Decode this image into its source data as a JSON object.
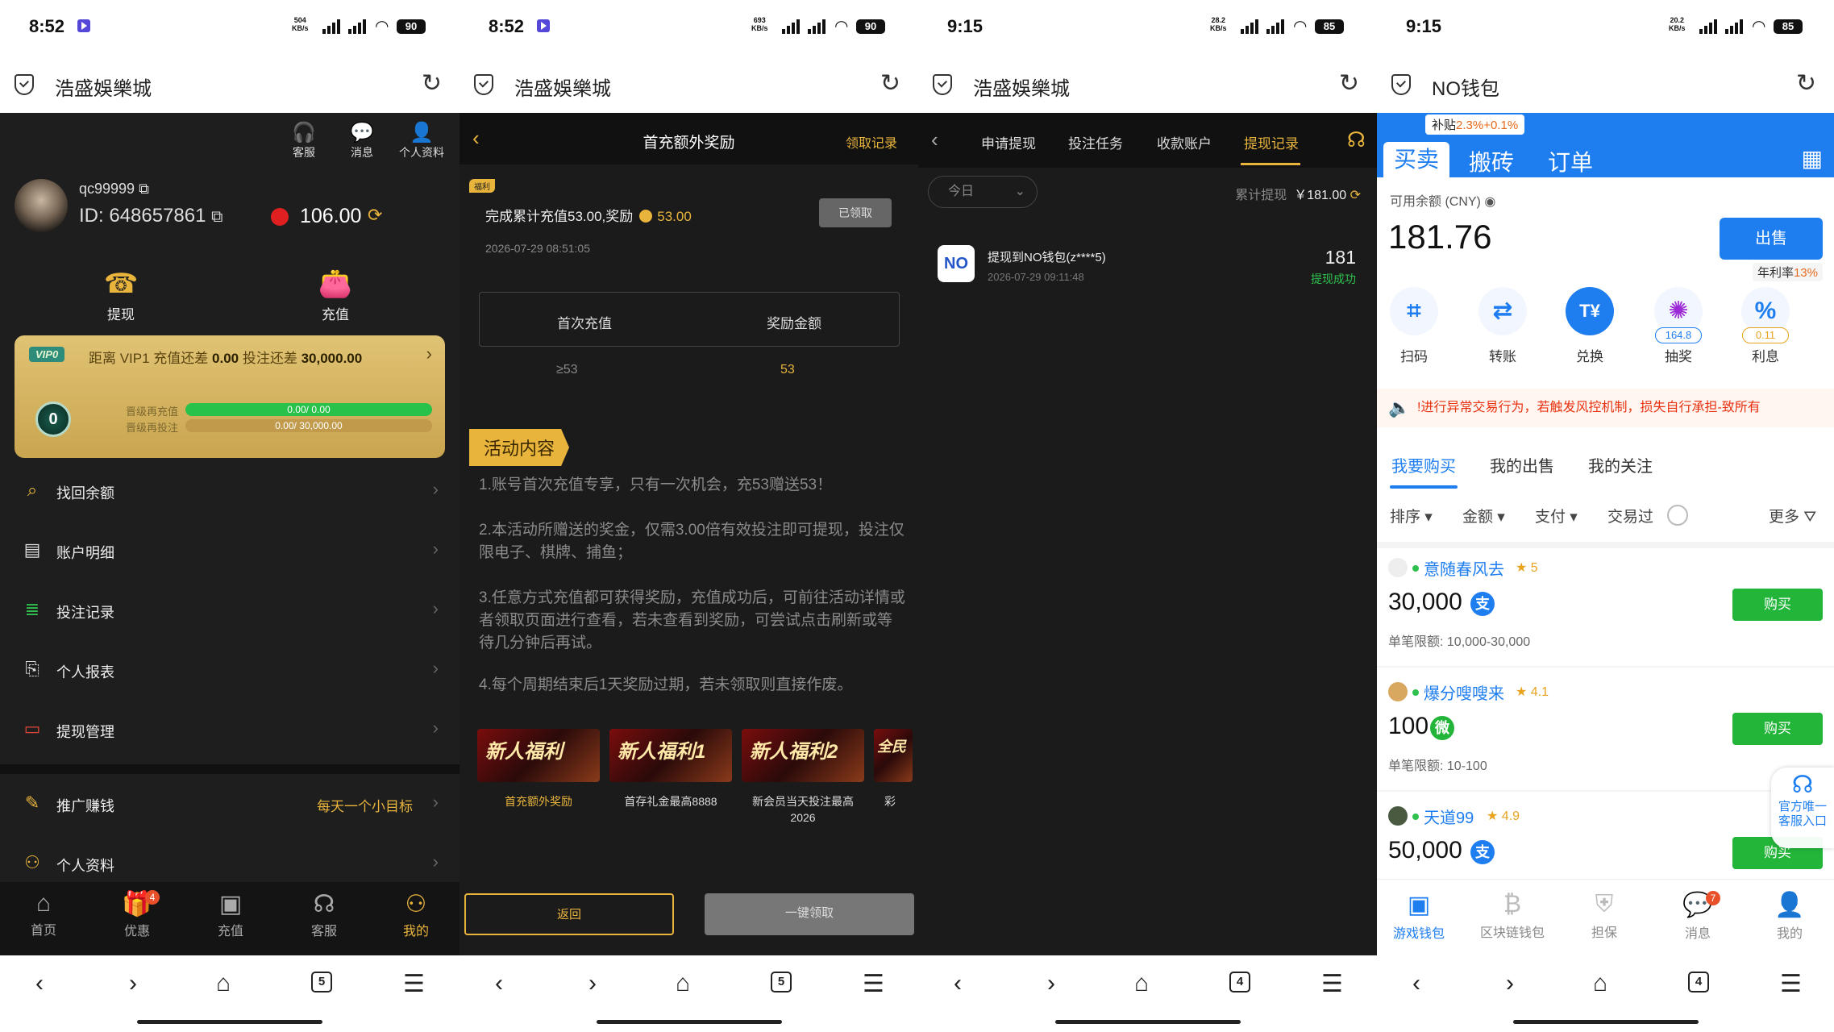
{
  "status_bars": [
    {
      "time": "8:52",
      "net": "504\nKB/s",
      "sig": "5G",
      "batt": "90"
    },
    {
      "time": "8:52",
      "net": "693\nKB/s",
      "sig": "5G",
      "batt": "90"
    },
    {
      "time": "9:15",
      "net": "28.2\nKB/s",
      "sig": "5G",
      "batt": "85"
    },
    {
      "time": "9:15",
      "net": "20.2\nKB/s",
      "sig": "5G",
      "batt": "85"
    }
  ],
  "titles": [
    "浩盛娛樂城",
    "浩盛娛樂城",
    "浩盛娛樂城",
    "NO钱包"
  ],
  "nav_tabs_count": [
    "5",
    "5",
    "4",
    "4"
  ],
  "p0": {
    "quick": [
      "客服",
      "消息",
      "个人资料"
    ],
    "username": "qc99999",
    "uid_label": "ID:",
    "uid": "648657861",
    "balance": "106.00",
    "withdraw": "提现",
    "recharge": "充值",
    "vip_badge": "VIP0",
    "vip_text_pre": "距离 VIP1 充值还差 ",
    "vip_recharge_gap": "0.00",
    "vip_text_mid": " 投注还差 ",
    "vip_bet_gap": "30,000.00",
    "vip_level": "0",
    "vip_l1": "晋级再充值",
    "vip_l2": "晋级再投注",
    "vip_bar1": "0.00/ 0.00",
    "vip_bar2": "0.00/ 30,000.00",
    "vip_bar1_fill": 1.0,
    "vip_bar2_fill": 0.0,
    "menu": [
      "找回余额",
      "账户明细",
      "投注记录",
      "个人报表",
      "提现管理"
    ],
    "promo": "推广赚钱",
    "promo_extra": "每天一个小目标",
    "profile": "个人资料",
    "bottom": [
      "首页",
      "优惠",
      "充值",
      "客服",
      "我的"
    ],
    "badge": "4"
  },
  "p1": {
    "title": "首充额外奖励",
    "records": "领取记录",
    "tag": "福利",
    "task": "完成累计充值53.00,奖励",
    "task_amt": "53.00",
    "claimed": "已领取",
    "date": "2026-07-29 08:51:05",
    "col1": "首次充值",
    "col2": "奖励金额",
    "v1": "≥53",
    "v2": "53",
    "section": "活动内容",
    "rules": [
      "1.账号首次充值专享，只有一次机会，充53赠送53！",
      "2.本活动所赠送的奖金，仅需3.00倍有效投注即可提现，投注仅限电子、棋牌、捕鱼；",
      "3.任意方式充值都可获得奖励，充值成功后，可前往活动详情或者领取页面进行查看，若未查看到奖励，可尝试点击刷新或等待几分钟后再试。",
      "4.每个周期结束后1天奖励过期，若未领取则直接作废。"
    ],
    "banners": [
      "新人福利",
      "新人福利1",
      "新人福利2",
      "全民"
    ],
    "captions": [
      "首充额外奖励",
      "首存礼金最高8888",
      "新会员当天投注最高\n2026",
      "彩"
    ],
    "back": "返回",
    "claim_all": "一键领取"
  },
  "p2": {
    "tabs": [
      "申请提现",
      "投注任务",
      "收款账户",
      "提现记录"
    ],
    "filter": "今日",
    "total_label": "累计提现",
    "total": "￥181.00",
    "logo": "NO",
    "item_title": "提现到NO钱包(z****5)",
    "item_date": "2026-07-29 09:11:48",
    "item_amt": "181",
    "item_status": "提现成功"
  },
  "p3": {
    "subsidy_pre": "补贴",
    "subsidy": "2.3%+0.1%",
    "tabs": [
      "买卖",
      "搬砖",
      "订单"
    ],
    "avail": "可用余额 (CNY)",
    "amount": "181.76",
    "sell": "出售",
    "apr_pre": "年利率",
    "apr": "13%",
    "funcs": [
      "扫码",
      "转账",
      "兑换",
      "抽奖",
      "利息"
    ],
    "lottery_pill": "164.8",
    "interest_pill": "0.11",
    "notice": "!进行异常交易行为，若触发风控机制，损失自行承担-致所有",
    "subtabs": [
      "我要购买",
      "我的出售",
      "我的关注"
    ],
    "filters": [
      "排序",
      "金额",
      "支付",
      "交易过"
    ],
    "more": "更多",
    "merchants": [
      {
        "name": "意随春风去",
        "rating": "5",
        "amount": "30,000",
        "limit_label": "单笔限额:",
        "limit": "10,000-30,000",
        "pay": "alipay"
      },
      {
        "name": "爆分嗖嗖来",
        "rating": "4.1",
        "amount": "100",
        "limit_label": "单笔限额:",
        "limit": "10-100",
        "pay": "wechat"
      },
      {
        "name": "天道99",
        "rating": "4.9",
        "amount": "50,000",
        "limit_label": "",
        "limit": "",
        "pay": "alipay"
      }
    ],
    "buy": "购买",
    "cs": "官方唯一\n客服入口",
    "bottom": [
      "游戏钱包",
      "区块链钱包",
      "担保",
      "消息",
      "我的"
    ],
    "msg_badge": "7"
  }
}
